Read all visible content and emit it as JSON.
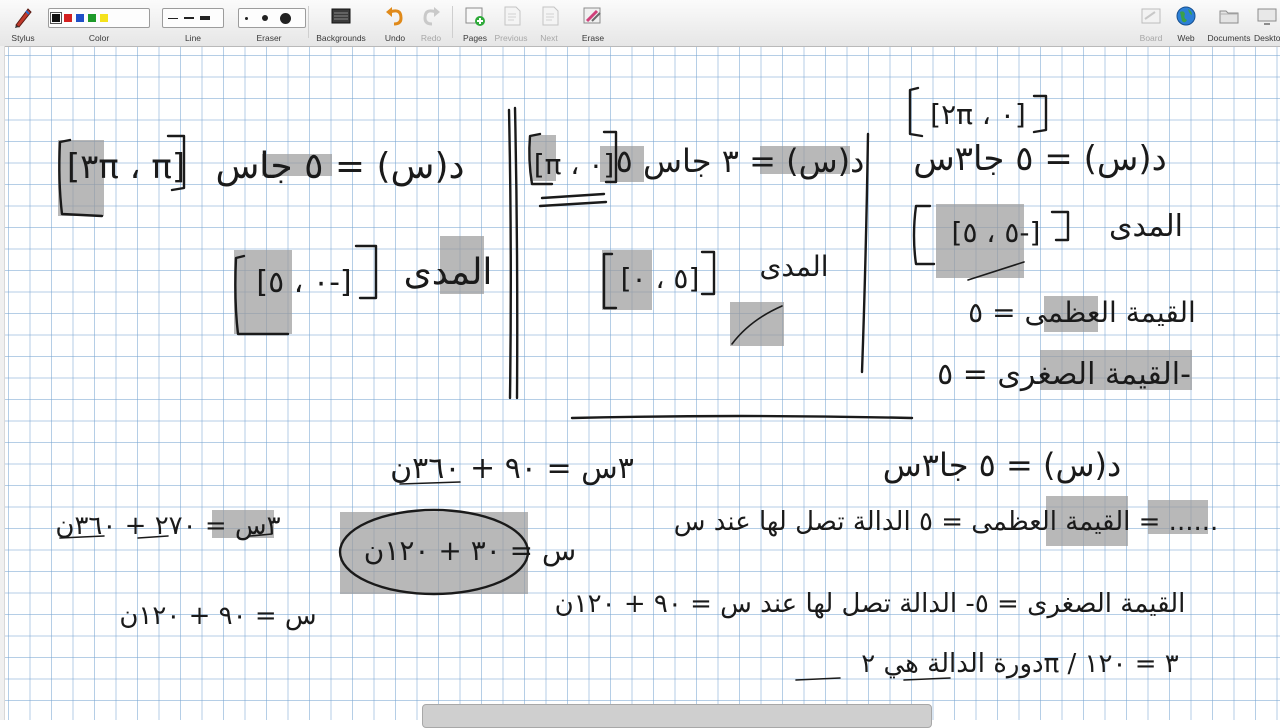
{
  "toolbar": {
    "stylus_label": "Stylus",
    "color_label": "Color",
    "line_label": "Line",
    "eraser_label": "Eraser",
    "backgrounds_label": "Backgrounds",
    "undo_label": "Undo",
    "redo_label": "Redo",
    "pages_label": "Pages",
    "previous_label": "Previous",
    "next_label": "Next",
    "erase_label": "Erase",
    "board_label": "Board",
    "web_label": "Web",
    "documents_label": "Documents",
    "desktop_label": "Deskto",
    "colors": [
      "#111111",
      "#d42020",
      "#1f4fc7",
      "#1e9a2a",
      "#f5e21c"
    ],
    "selected_color": "#111111"
  },
  "board": {
    "grid_color": "#78a5d2",
    "ink_color": "#1a1a1a",
    "highlight_color": "#9a9a9a",
    "handwriting": [
      "[٣π ، π]",
      "د(س) = ٥ جاس",
      "[٠ ، ٥-]",
      "المدى",
      "[π ، ٠]",
      "د(س) = ٣ جاس ٥",
      "[٥ ، ٠]",
      "المدى",
      "[٢π ، ٠]",
      "د(س) = ٥ جا٣س",
      "[٥ ، ٥-]",
      "المدى",
      "القيمة العظمى = ٥",
      "القيمة الصغرى = ٥-",
      "٣س = ٩٠ + ٣٦٠ن",
      "د(س) = ٥ جا٣س",
      "س = ٣٠ + ١٢٠ن",
      "القيمة العظمى = ٥ الدالة تصل لها عند س = ......",
      "٣س = ٢٧٠ + ٣٦٠ن",
      "س = ٩٠ + ١٢٠ن",
      "القيمة الصغرى = ٥- الدالة تصل لها عند س = ٩٠ + ١٢٠ن",
      "دورة الدالة هي ٢π / ٣ = ١٢٠"
    ]
  }
}
